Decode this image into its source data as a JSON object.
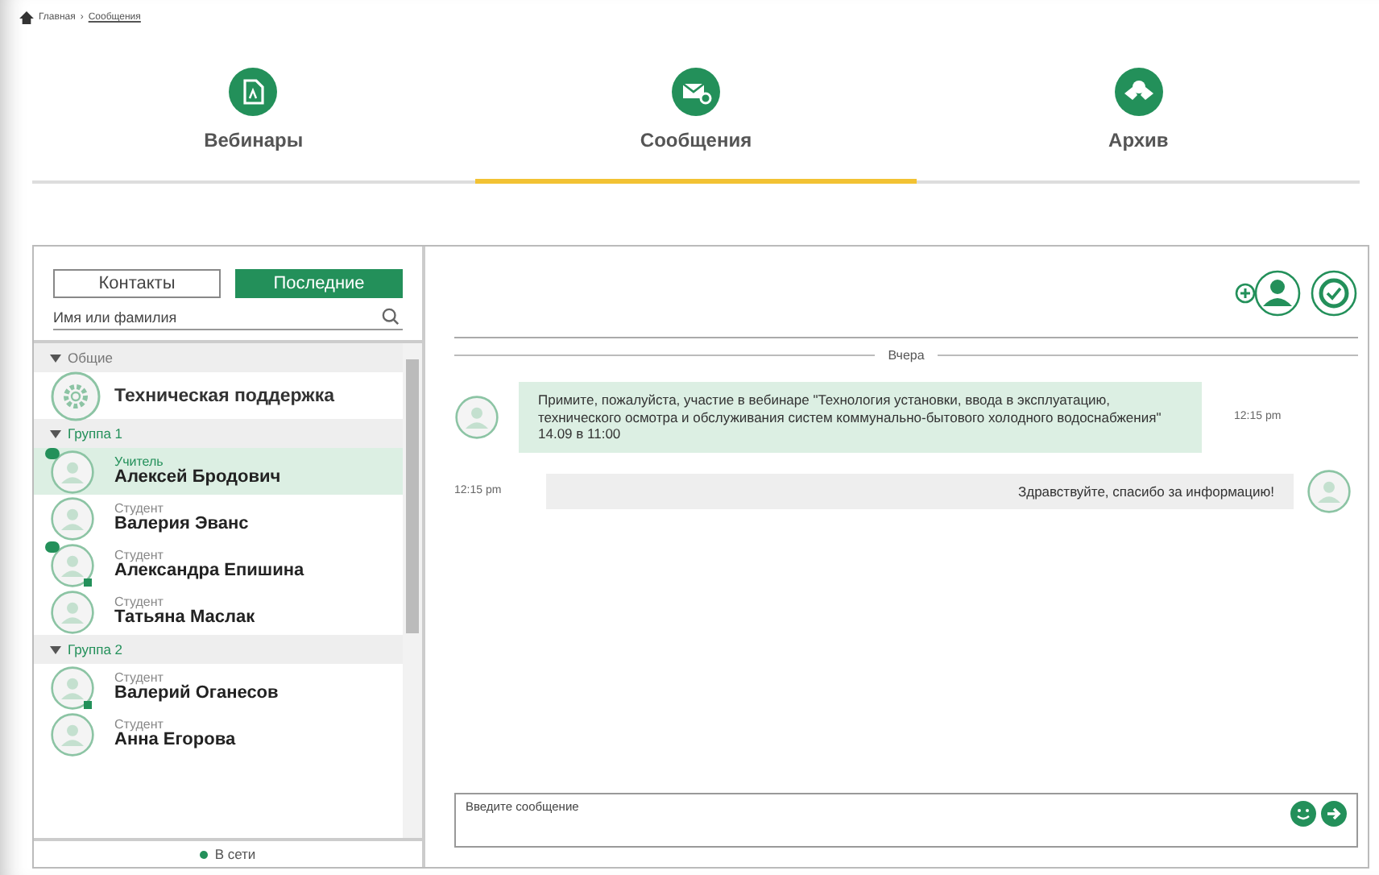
{
  "breadcrumb": {
    "home": "Главная",
    "separator": "›",
    "current": "Сообщения"
  },
  "tabs": [
    {
      "label": "Вебинары",
      "selected": false
    },
    {
      "label": "Сообщения",
      "selected": true
    },
    {
      "label": "Архив",
      "selected": false
    }
  ],
  "sidebar": {
    "toggle": [
      {
        "label": "Контакты",
        "selected": false
      },
      {
        "label": "Последние",
        "selected": true
      }
    ],
    "search": {
      "placeholder": "Имя или фамилия"
    },
    "groups": [
      {
        "title": "Общие",
        "expanded": true,
        "accent": false,
        "items": [
          {
            "kind": "service",
            "name": "Техническая поддержка",
            "selected": false
          }
        ]
      },
      {
        "title": "Группа 1",
        "expanded": true,
        "accent": true,
        "items": [
          {
            "kind": "person",
            "role": "Учитель",
            "name": "Алексей Бродович",
            "selected": true,
            "unread": true,
            "online": false
          },
          {
            "kind": "person",
            "role": "Студент",
            "name": "Валерия Эванс",
            "selected": false,
            "unread": false,
            "online": false
          },
          {
            "kind": "person",
            "role": "Студент",
            "name": "Александра Епишина",
            "selected": false,
            "unread": true,
            "online": true
          },
          {
            "kind": "person",
            "role": "Студент",
            "name": "Татьяна Маслак",
            "selected": false,
            "unread": false,
            "online": false
          }
        ]
      },
      {
        "title": "Группа 2",
        "expanded": true,
        "accent": true,
        "items": [
          {
            "kind": "person",
            "role": "Студент",
            "name": "Валерий Оганесов",
            "selected": false,
            "unread": false,
            "online": true
          },
          {
            "kind": "person",
            "role": "Студент",
            "name": "Анна Егорова",
            "selected": false,
            "unread": false,
            "online": false
          }
        ]
      }
    ],
    "legend": "В сети"
  },
  "chat": {
    "day": "Вчера",
    "messages": [
      {
        "kind": "incoming",
        "text": "Примите, пожалуйста, участие в вебинаре \"Технология установки, ввода в эксплуатацию, технического осмотра и обслуживания систем коммунально-бытового холодного водоснабжения\" 14.09 в 11:00",
        "time": "12:15 pm"
      },
      {
        "kind": "outgoing",
        "text": "Здравствуйте, спасибо за информацию!",
        "time": "12:15 pm"
      }
    ],
    "composer": {
      "placeholder": "Введите сообщение"
    }
  }
}
